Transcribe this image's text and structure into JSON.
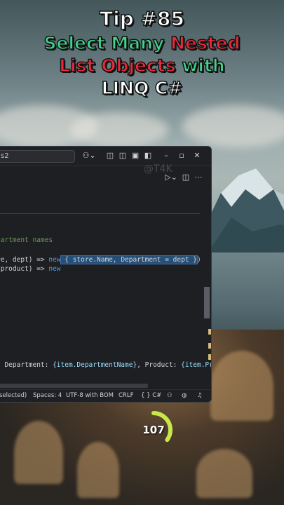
{
  "header": {
    "tip": "Tip #85",
    "line1_a": "Select Many ",
    "line1_b": "Nested",
    "line2_a": "List Objects ",
    "line2_b": "with",
    "line3": "LINQ C#"
  },
  "editor": {
    "search_text": "s2",
    "watermark": "@T4K",
    "code_lines": {
      "comment": "partment names",
      "l2_pre": "re, dept) => ",
      "l2_kw": "new",
      "l2_sel": " { store.Name, Department = dept }",
      "l2_post": ")",
      "l3_pre": " product) => ",
      "l3_kw": "new",
      "l4_a": ", Department: ",
      "l4_b": "{item.DepartmentName}",
      "l4_c": ", Product: ",
      "l4_d": "{item.Pr"
    },
    "status": {
      "selected": "selected)",
      "spaces": "Spaces: 4",
      "encoding": "UTF-8 with BOM",
      "line_ending": "CRLF",
      "language": "{ } C#"
    },
    "colors": {
      "background": "#1e1f22",
      "selection": "#264f78",
      "comment": "#6a9955",
      "keyword": "#569cd6"
    }
  },
  "counter": {
    "value": "107",
    "progress": 0.35,
    "color": "#c8e84a"
  }
}
